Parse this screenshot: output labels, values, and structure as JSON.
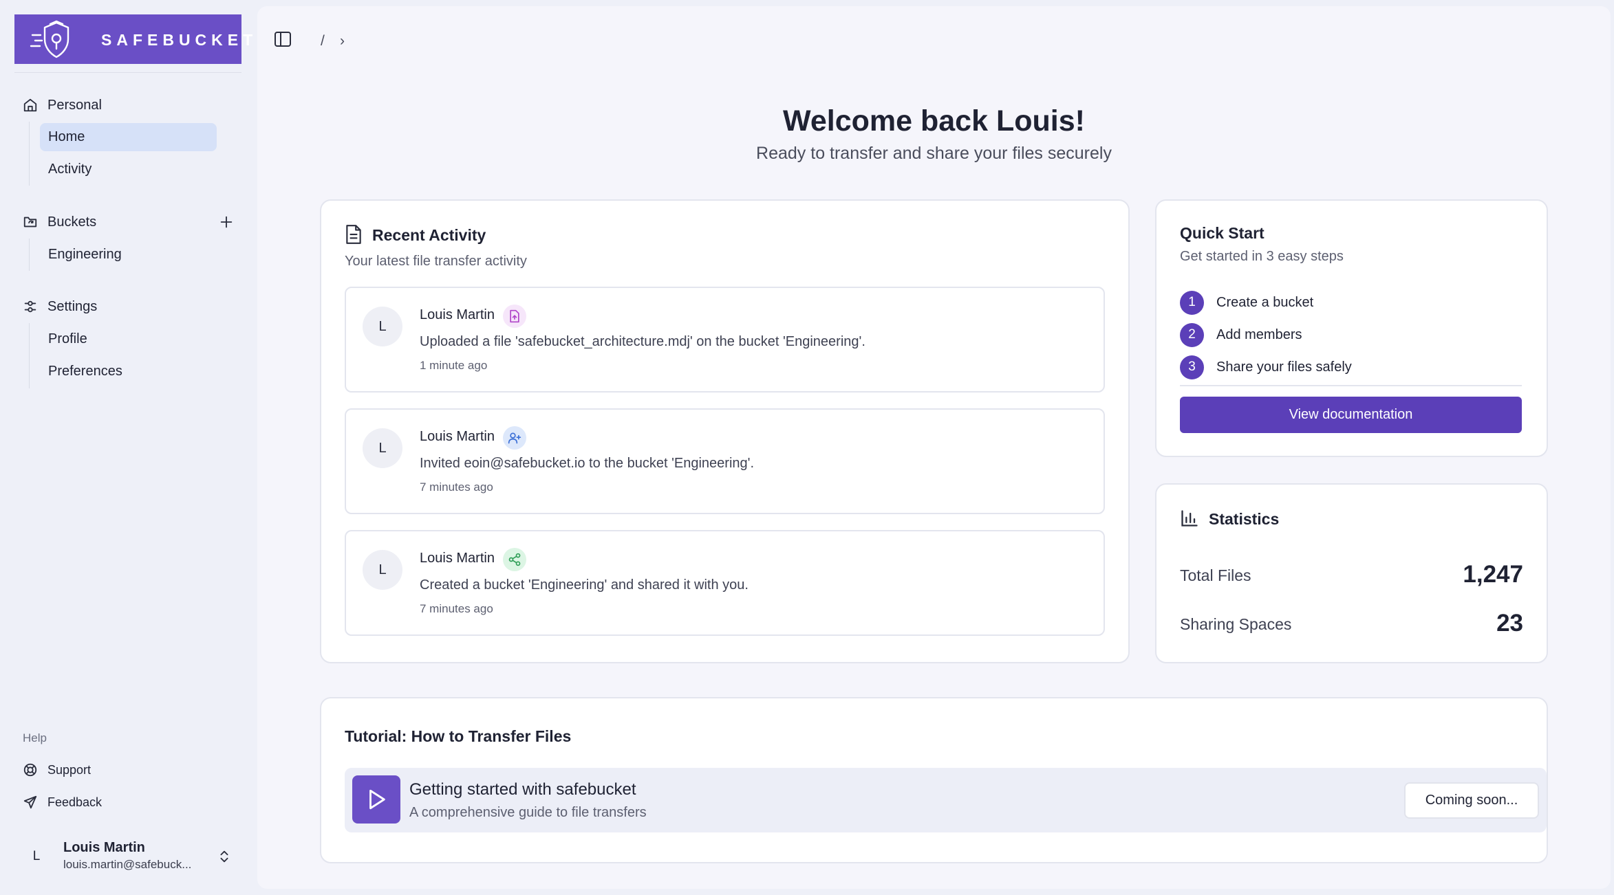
{
  "brand": {
    "name": "SAFEBUCKET"
  },
  "sidebar": {
    "groups": [
      {
        "label": "Personal",
        "icon": "home-icon",
        "items": [
          {
            "label": "Home",
            "active": true
          },
          {
            "label": "Activity",
            "active": false
          }
        ]
      },
      {
        "label": "Buckets",
        "icon": "folder-sync-icon",
        "items": [
          {
            "label": "Engineering",
            "active": false
          }
        ]
      },
      {
        "label": "Settings",
        "icon": "settings-sliders-icon",
        "items": [
          {
            "label": "Profile",
            "active": false
          },
          {
            "label": "Preferences",
            "active": false
          }
        ]
      }
    ],
    "help": {
      "label": "Help",
      "items": [
        {
          "label": "Support",
          "icon": "lifebuoy-icon"
        },
        {
          "label": "Feedback",
          "icon": "send-icon"
        }
      ]
    },
    "user": {
      "initial": "L",
      "name": "Louis Martin",
      "email": "louis.martin@safebuck..."
    }
  },
  "header": {
    "breadcrumb_separator": "/",
    "breadcrumb_chevron": "›"
  },
  "main": {
    "welcome": "Welcome back Louis!",
    "tagline": "Ready to transfer and share your files securely",
    "recent_activity": {
      "title": "Recent Activity",
      "subtitle": "Your latest file transfer activity",
      "items": [
        {
          "initial": "L",
          "name": "Louis Martin",
          "icon": "file-upload-icon",
          "description": "Uploaded a file 'safebucket_architecture.mdj' on the bucket 'Engineering'.",
          "time": "1 minute ago"
        },
        {
          "initial": "L",
          "name": "Louis Martin",
          "icon": "user-plus-icon",
          "description": "Invited eoin@safebucket.io to the bucket 'Engineering'.",
          "time": "7 minutes ago"
        },
        {
          "initial": "L",
          "name": "Louis Martin",
          "icon": "share-icon",
          "description": "Created a bucket 'Engineering' and shared it with you.",
          "time": "7 minutes ago"
        }
      ]
    },
    "quick_start": {
      "title": "Quick Start",
      "subtitle": "Get started in 3 easy steps",
      "steps": [
        {
          "num": "1",
          "label": "Create a bucket"
        },
        {
          "num": "2",
          "label": "Add members"
        },
        {
          "num": "3",
          "label": "Share your files safely"
        }
      ],
      "button": "View documentation"
    },
    "statistics": {
      "title": "Statistics",
      "rows": [
        {
          "label": "Total Files",
          "value": "1,247"
        },
        {
          "label": "Sharing Spaces",
          "value": "23"
        }
      ]
    },
    "tutorial": {
      "title": "Tutorial: How to Transfer Files",
      "item_title": "Getting started with safebucket",
      "item_subtitle": "A comprehensive guide to file transfers",
      "button": "Coming soon..."
    }
  },
  "colors": {
    "brand": "#6a4fc6",
    "accent": "#5b3fb8",
    "active_nav": "#d6e1f8",
    "background": "#eef0f8",
    "panel": "#f5f5fb"
  }
}
